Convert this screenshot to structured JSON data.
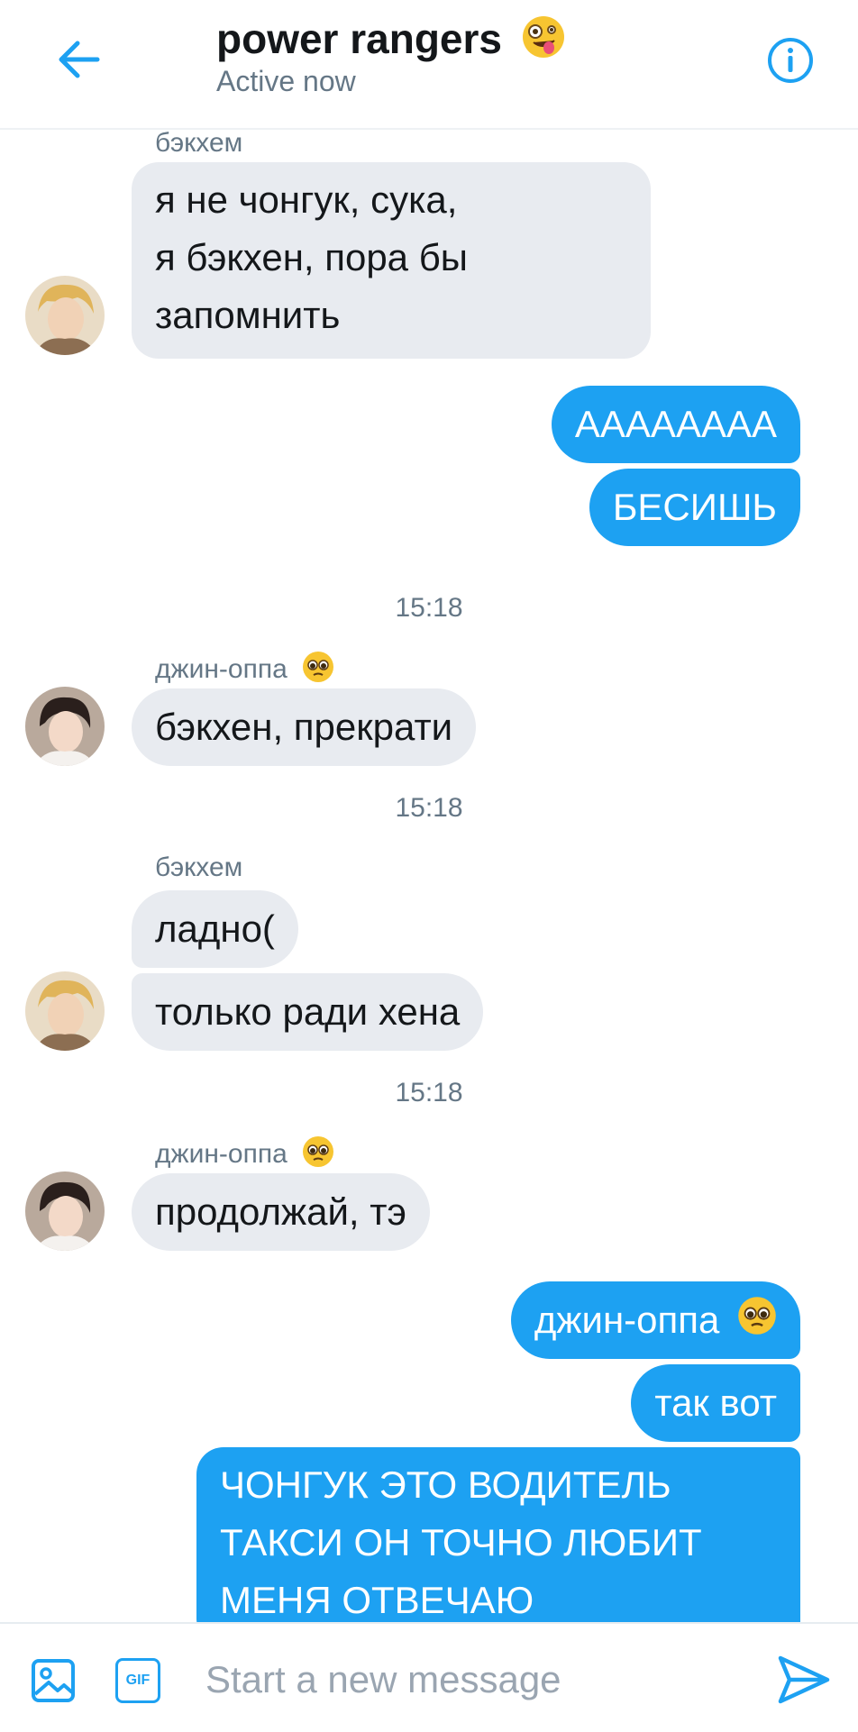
{
  "header": {
    "back_icon": "arrow-left-icon",
    "title": "power rangers",
    "title_emoji": "zany-face-emoji",
    "status": "Active now",
    "info_icon": "info-icon",
    "accent": "#1da1f2"
  },
  "messages": {
    "m1_sender": "бэкхем",
    "m1_lines": [
      "я не чонгук, сука,",
      "я бэкхен, пора бы",
      "запомнить"
    ],
    "m2_out_a": "АААААААА",
    "m2_out_b": "БЕСИШЬ",
    "t1": "15:18",
    "m3_sender": "джин-оппа",
    "m3_text": "бэкхен, прекрати",
    "t2": "15:18",
    "m4_sender": "бэкхем",
    "m4_a": "ладно(",
    "m4_b": "только ради хена",
    "t3": "15:18",
    "m5_sender": "джин-оппа",
    "m5_text": "продолжай, тэ",
    "m6_out_a": "джин-оппа",
    "m6_out_b": "так вот",
    "m6_out_c_lines": [
      "ЧОНГУК ЭТО ВОДИТЕЛЬ",
      "ТАКСИ ОН ТОЧНО ЛЮБИТ",
      "МЕНЯ ОТВЕЧАЮ"
    ]
  },
  "composer": {
    "image_icon": "image-icon",
    "gif_label": "GIF",
    "placeholder": "Start a new message",
    "send_icon": "send-icon"
  },
  "colors": {
    "incoming_bubble": "#e8ebf0",
    "outgoing_bubble": "#1da1f2",
    "muted_text": "#657786"
  }
}
